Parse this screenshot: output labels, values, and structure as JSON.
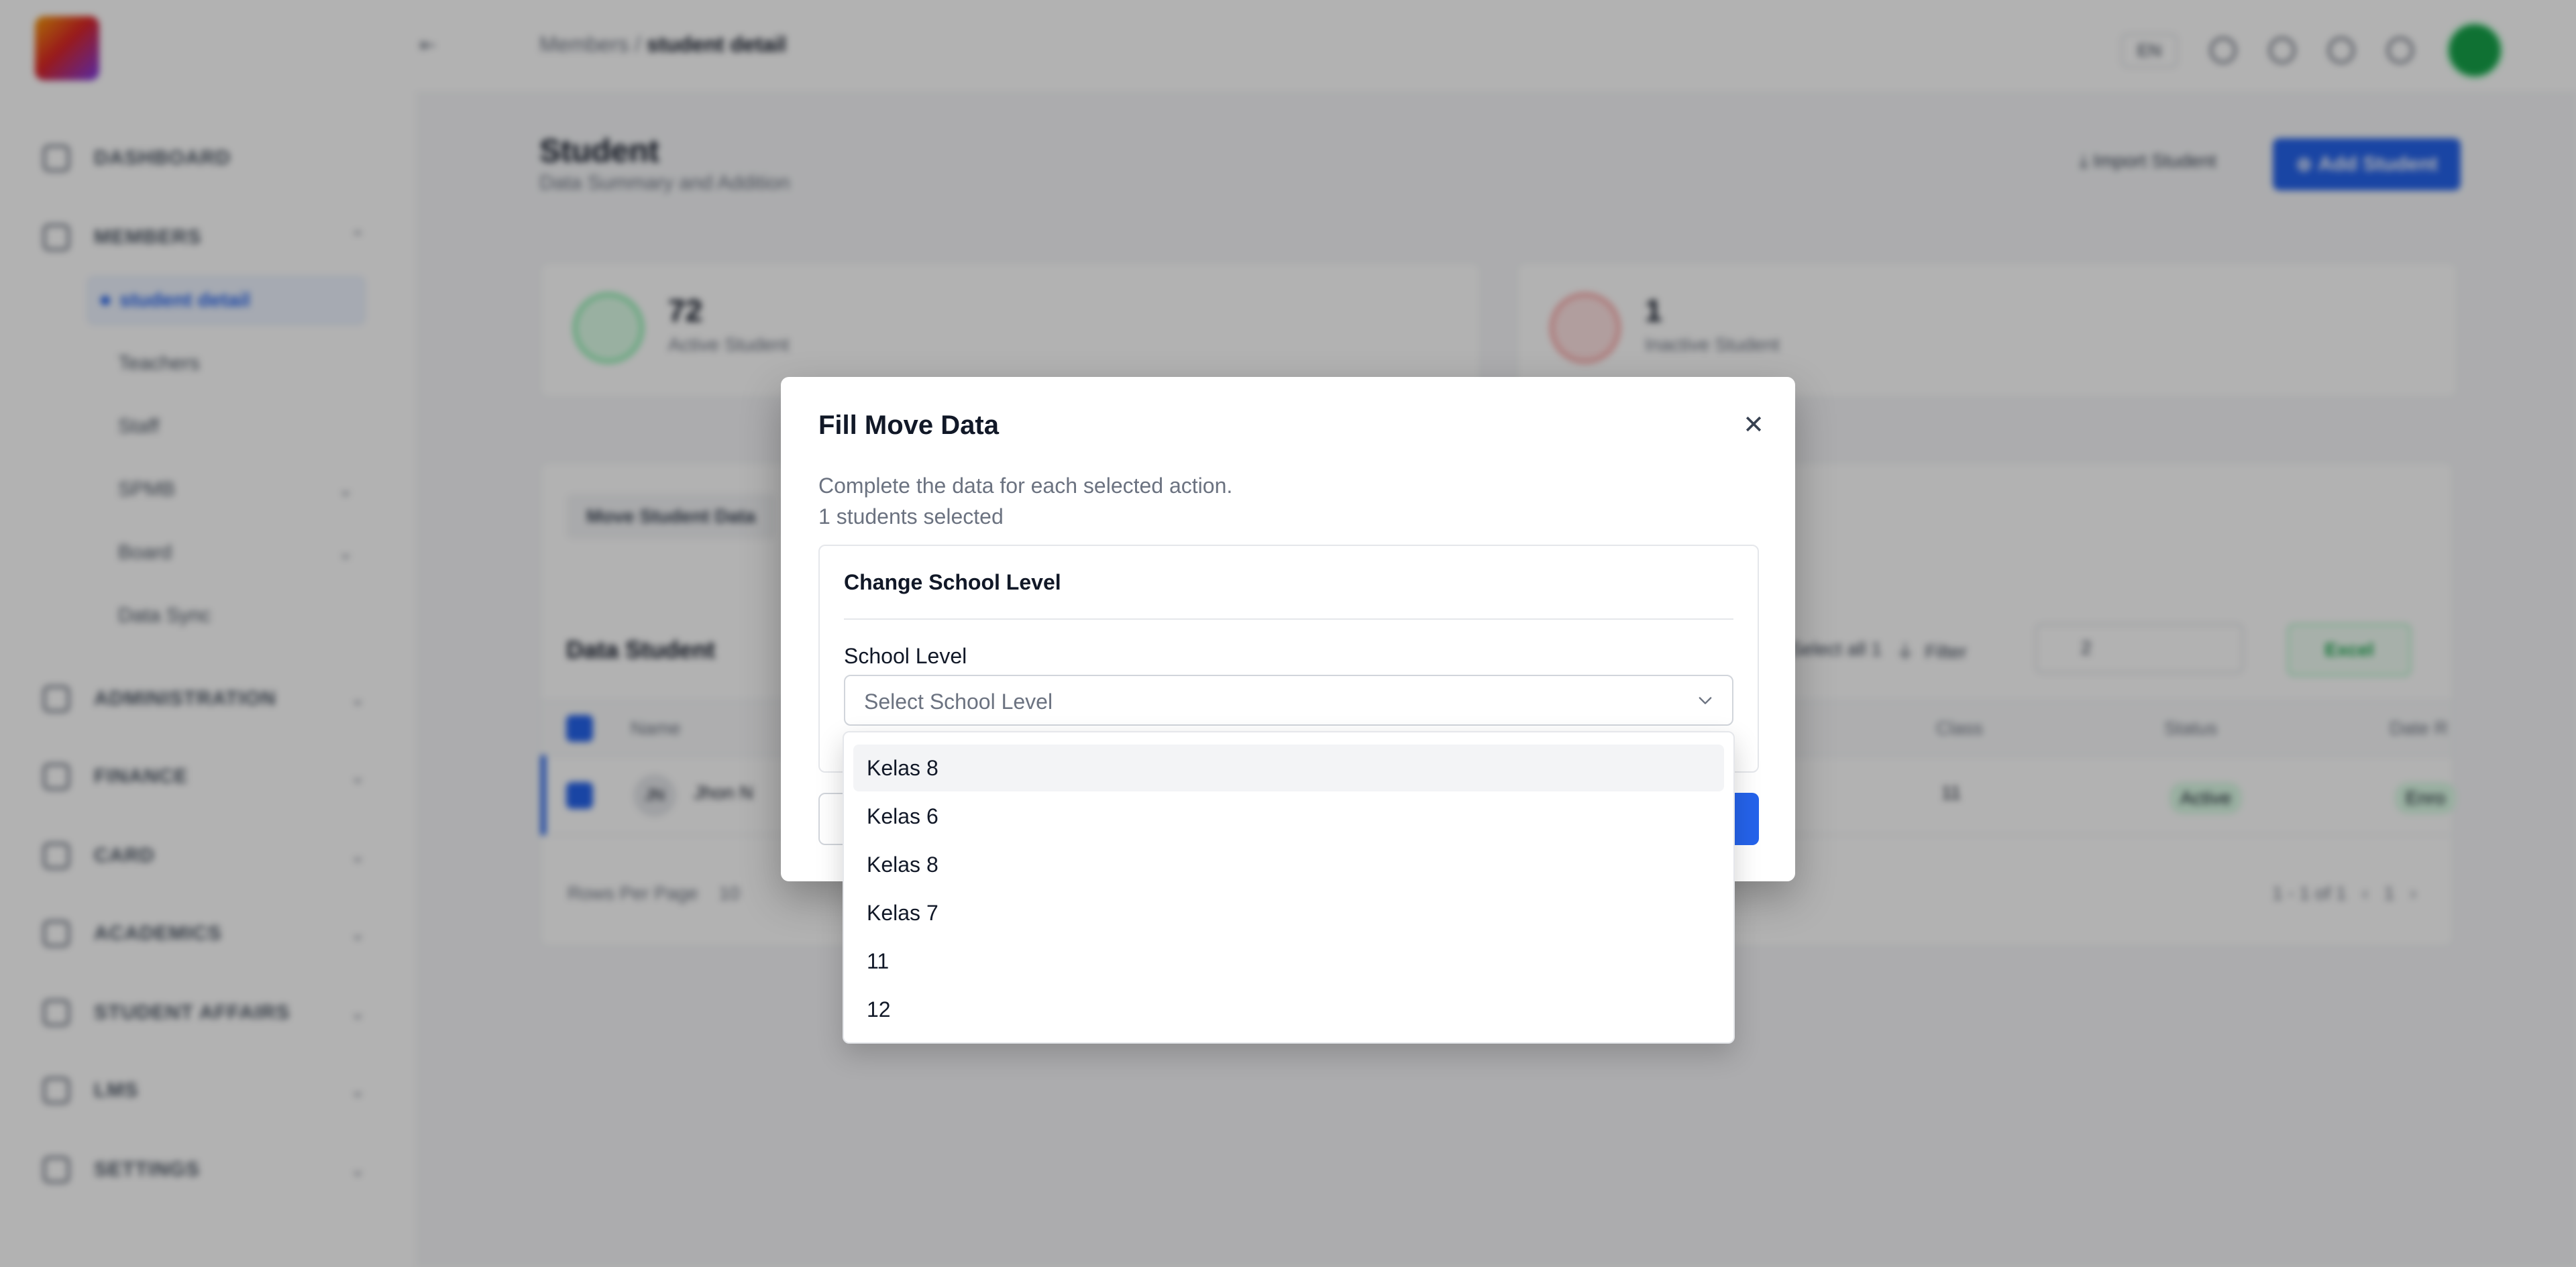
{
  "breadcrumb": {
    "parent": "Members",
    "current": "student detail"
  },
  "topbar": {
    "lang": "EN"
  },
  "sidebar": {
    "items": [
      {
        "label": "DASHBOARD"
      },
      {
        "label": "MEMBERS"
      },
      {
        "label": "ADMINISTRATION"
      },
      {
        "label": "FINANCE"
      },
      {
        "label": "CARD"
      },
      {
        "label": "ACADEMICS"
      },
      {
        "label": "STUDENT AFFAIRS"
      },
      {
        "label": "LMS"
      },
      {
        "label": "SETTINGS"
      }
    ],
    "members_sub": [
      {
        "label": "student detail"
      },
      {
        "label": "Teachers"
      },
      {
        "label": "Staff"
      },
      {
        "label": "SPMB"
      },
      {
        "label": "Board"
      },
      {
        "label": "Data Sync"
      }
    ]
  },
  "page": {
    "title": "Student",
    "subtitle": "Data Summary and Addition",
    "import_label": "Import Student",
    "add_label": "Add Student"
  },
  "stats": [
    {
      "value": "72",
      "label": "Active Student",
      "color": "#16a34a"
    },
    {
      "value": "1",
      "label": "Inactive Student",
      "color": "#dc2626"
    }
  ],
  "table": {
    "tab": "Move Student Data",
    "title": "Data Student",
    "select_all": "Select all 1",
    "filter": "Filter",
    "search_value": "2",
    "excel": "Excel",
    "headers": {
      "name": "Name",
      "class": "Class",
      "status": "Status",
      "date": "Date R"
    },
    "row": {
      "initials": "JN",
      "name": "Jhon N",
      "class": "11",
      "status": "Active",
      "extra": "Enro"
    },
    "rows_per_page": "Rows Per Page",
    "rows_value": "10",
    "range": "1 - 1 of 1",
    "page": "1"
  },
  "modal": {
    "title": "Fill Move Data",
    "description": "Complete the data for each selected action.",
    "count": "1 students selected",
    "section_title": "Change School Level",
    "field_label": "School Level",
    "placeholder": "Select School Level",
    "close_glyph": "✕"
  },
  "dropdown": {
    "options": [
      "Kelas 8",
      "Kelas 6",
      "Kelas 8",
      "Kelas 7",
      "11",
      "12"
    ],
    "highlighted_index": 0
  },
  "colors": {
    "primary": "#2563eb",
    "success": "#16a34a",
    "danger": "#dc2626"
  }
}
